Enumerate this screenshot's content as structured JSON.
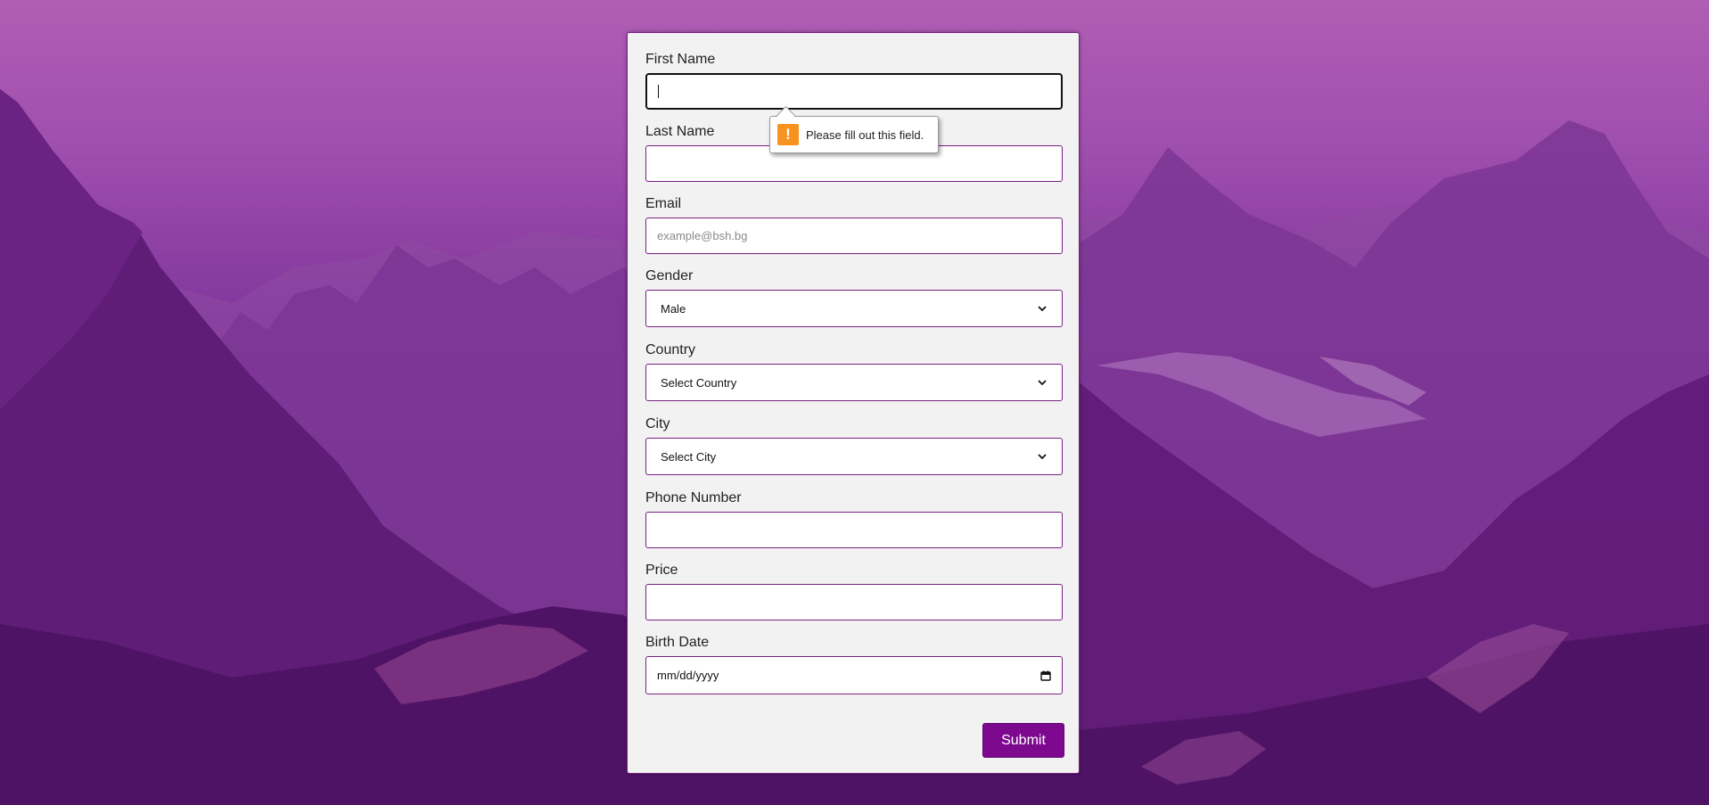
{
  "form": {
    "first_name": {
      "label": "First Name",
      "value": ""
    },
    "last_name": {
      "label": "Last Name",
      "value": ""
    },
    "email": {
      "label": "Email",
      "placeholder": "example@bsh.bg"
    },
    "gender": {
      "label": "Gender",
      "selected": "Male"
    },
    "country": {
      "label": "Country",
      "selected": "Select Country"
    },
    "city": {
      "label": "City",
      "selected": "Select City"
    },
    "phone": {
      "label": "Phone Number",
      "value": ""
    },
    "price": {
      "label": "Price",
      "value": ""
    },
    "birth_date": {
      "label": "Birth Date",
      "placeholder": "mm/dd/yyyy"
    },
    "submit_label": "Submit"
  },
  "validation": {
    "message": "Please fill out this field."
  },
  "colors": {
    "accent": "#7d0a8e",
    "card_bg": "#f2f2f2",
    "warning": "#f7931e"
  },
  "icons": {
    "warning": "warning-icon",
    "dropdown": "chevron-down-icon",
    "calendar": "calendar-icon"
  }
}
